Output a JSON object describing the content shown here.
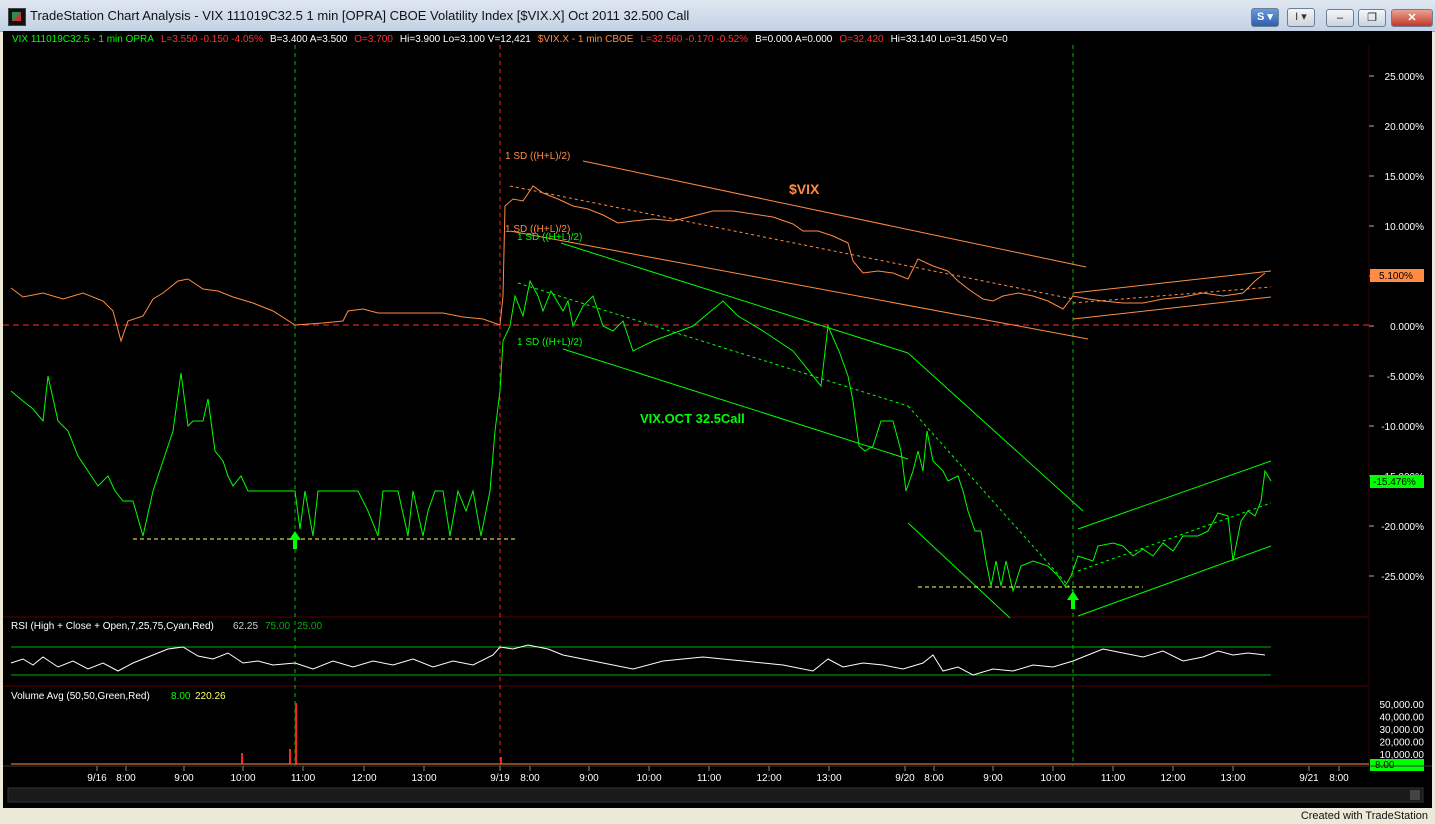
{
  "window": {
    "title": "TradeStation Chart Analysis - VIX 111019C32.5 1 min [OPRA] CBOE Volatility Index [$VIX.X] Oct 2011 32.500 Call",
    "s_button": "S",
    "i_button": "I",
    "minimize": "–",
    "restore": "❐",
    "close": "✕"
  },
  "legend_main": [
    {
      "text": "VIX 111019C32.5 - 1 min  OPRA",
      "color": "#00ff00"
    },
    {
      "text": "L=3.550  -0.150  -4.05%",
      "color": "#ff3030"
    },
    {
      "text": "B=3.400  A=3.500",
      "color": "#ffffff"
    },
    {
      "text": "O=3.700",
      "color": "#ff3030"
    },
    {
      "text": "Hi=3.900  Lo=3.100  V=12,421",
      "color": "#ffffff"
    },
    {
      "text": "$VIX.X - 1 min  CBOE",
      "color": "#ff8c42"
    },
    {
      "text": "L=32.560  -0.170  -0.52%",
      "color": "#ff3030"
    },
    {
      "text": "B=0.000  A=0.000",
      "color": "#ffffff"
    },
    {
      "text": "O=32.420",
      "color": "#ff3030"
    },
    {
      "text": "Hi=33.140  Lo=31.450  V=0",
      "color": "#ffffff"
    }
  ],
  "annotations": {
    "vix_label": "$VIX",
    "call_label": "VIX.OCT 32.5Call",
    "sd_vix_top": "1 SD ((H+L)/2)",
    "sd_vix_bottom": "1 SD ((H+L)/2)",
    "sd_call_top": "1 SD ((H+L)/2)",
    "sd_call_bottom": "1 SD ((H+L)/2)"
  },
  "rsi_legend": {
    "label": "RSI (High + Close + Open,7,25,75,Cyan,Red)",
    "value": "62.25",
    "over": "75.00",
    "under": "25.00"
  },
  "volume_legend": {
    "label": "Volume Avg (50,50,Green,Red)",
    "value": "8.00",
    "avg": "220.26"
  },
  "price_axis_ticks": [
    "25.000%",
    "20.000%",
    "15.000%",
    "10.000%",
    "5.000%",
    "0.000%",
    "-5.000%",
    "-10.000%",
    "-15.000%",
    "-20.000%",
    "-25.000%"
  ],
  "price_markers": {
    "vix": "5.100%",
    "call": "-15.476%"
  },
  "volume_axis_ticks": [
    "50,000.00",
    "40,000.00",
    "30,000.00",
    "20,000.00",
    "10,000.00"
  ],
  "volume_marker": "8.00",
  "time_axis": [
    "9/16",
    "8:00",
    "9:00",
    "10:00",
    "11:00",
    "12:00",
    "13:00",
    "9/19",
    "8:00",
    "9:00",
    "10:00",
    "11:00",
    "12:00",
    "13:00",
    "9/20",
    "8:00",
    "9:00",
    "10:00",
    "11:00",
    "12:00",
    "13:00",
    "9/21",
    "8:00"
  ],
  "footer": "Created with TradeStation",
  "colors": {
    "background": "#000000",
    "call_line": "#00ff00",
    "vix_line": "#ff8c42",
    "zero_line": "#ff3030",
    "session_divider_red": "#ff2020",
    "session_divider_green": "#00c000",
    "support_line": "#ffff66",
    "rsi_line": "#ffffff",
    "rsi_band": "#00b000"
  }
}
